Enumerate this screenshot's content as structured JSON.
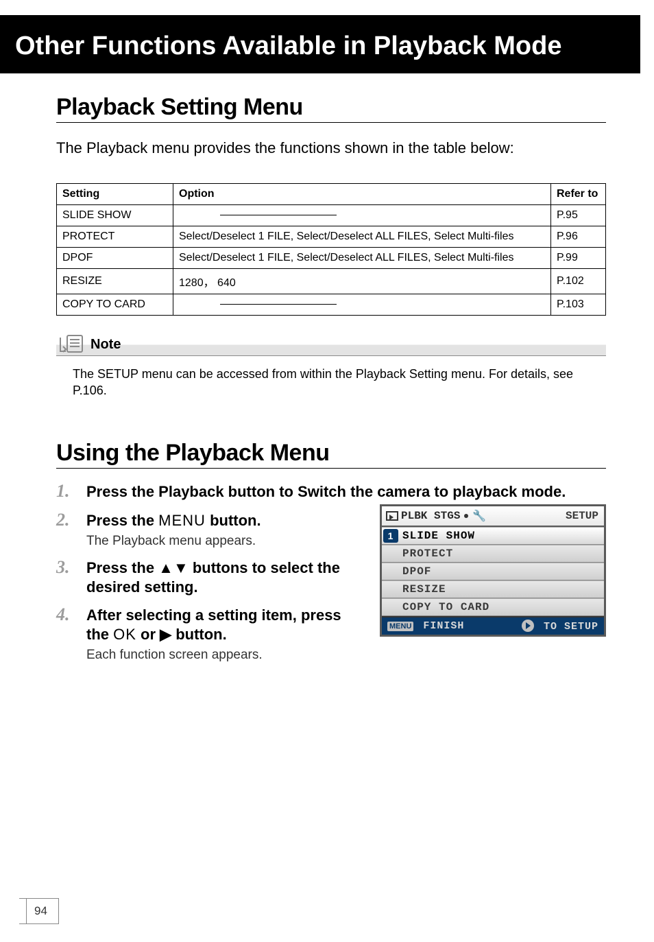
{
  "chapter_title": "Other Functions Available in Playback Mode",
  "section1": {
    "heading": "Playback Setting Menu",
    "intro": "The Playback menu provides the functions shown in the table below:"
  },
  "table": {
    "headers": {
      "c1": "Setting",
      "c2": "Option",
      "c3": "Refer to"
    },
    "rows": [
      {
        "setting": "SLIDE SHOW",
        "option_dash": true,
        "option": "",
        "ref": "P.95"
      },
      {
        "setting": "PROTECT",
        "option_dash": false,
        "option": "Select/Deselect 1 FILE, Select/Deselect ALL FILES, Select Multi-files",
        "ref": "P.96"
      },
      {
        "setting": "DPOF",
        "option_dash": false,
        "option": "Select/Deselect 1 FILE, Select/Deselect ALL FILES, Select Multi-files",
        "ref": "P.99"
      },
      {
        "setting": "RESIZE",
        "option_dash": false,
        "option": "1280， 640",
        "ref": "P.102"
      },
      {
        "setting": "COPY TO CARD",
        "option_dash": true,
        "option": "",
        "ref": "P.103"
      }
    ]
  },
  "note": {
    "label": "Note",
    "text": "The SETUP menu can be accessed from within the Playback Setting menu. For details, see P.106."
  },
  "section2": {
    "heading": "Using the Playback Menu"
  },
  "steps": {
    "s1": {
      "num": "1.",
      "title": "Press the Playback button to Switch the camera to playback mode."
    },
    "s2": {
      "num": "2.",
      "title_pre": "Press the ",
      "btn": "MENU",
      "title_post": " button.",
      "sub": "The Playback menu appears."
    },
    "s3": {
      "num": "3.",
      "title_pre": "Press the ",
      "title_post": " buttons to select the desired setting."
    },
    "s4": {
      "num": "4.",
      "title_pre": "After selecting a setting item, press the ",
      "btn": "OK",
      "title_mid": " or ",
      "title_post": " button.",
      "sub": "Each function screen appears."
    }
  },
  "lcd": {
    "tab_label": "PLBK STGS",
    "setup_label": "SETUP",
    "items": [
      "SLIDE SHOW",
      "PROTECT",
      "DPOF",
      "RESIZE",
      "COPY TO CARD"
    ],
    "selected_index": 0,
    "marker": "1",
    "bottom_left_btn": "MENU",
    "bottom_left": "FINISH",
    "bottom_right": "TO SETUP"
  },
  "page_number": "94"
}
